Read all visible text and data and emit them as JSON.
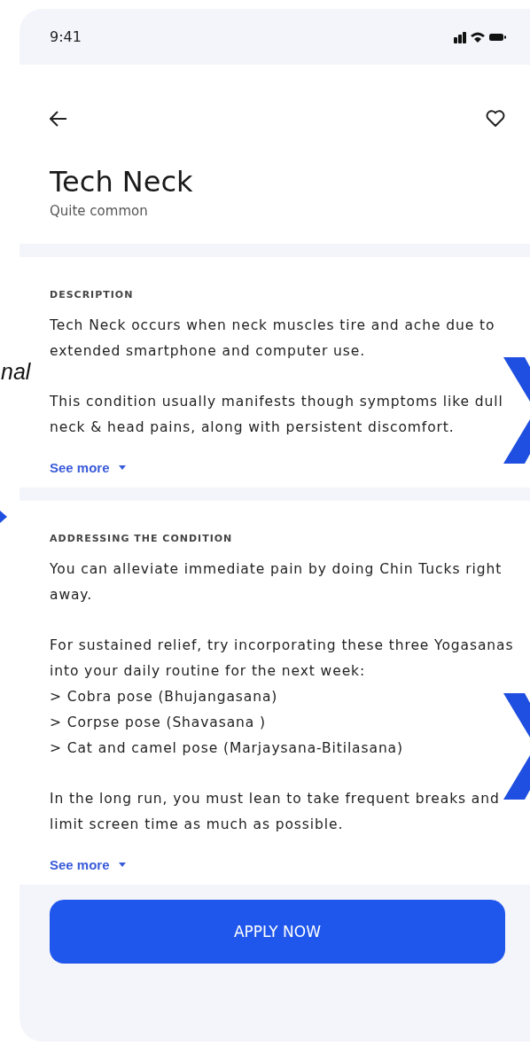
{
  "slide_fragment": {
    "text": "nal"
  },
  "status_bar": {
    "time": "9:41"
  },
  "header": {
    "title": "Tech Neck",
    "subtitle": "Quite common",
    "favorite": false
  },
  "sections": [
    {
      "heading": "DESCRIPTION",
      "paragraphs": [
        {
          "text": "Tech Neck occurs when neck muscles tire and ache due to extended smartphone and computer use."
        },
        {
          "text": "This condition usually manifests though symptoms like dull neck & head pains, along with persistent discomfort."
        }
      ],
      "link": "See more"
    },
    {
      "heading": "ADDRESSING THE CONDITION",
      "paragraphs": [
        {
          "text": "You can alleviate immediate pain by doing Chin Tucks right away."
        },
        {
          "text": "For sustained relief, try incorporating these three Yogasanas into your daily routine for the next week:",
          "items": [
            "> Cobra pose (Bhujangasana)",
            "> Corpse pose (Shavasana )",
            "> Cat and camel pose (Marjaysana-Bitilasana)"
          ]
        },
        {
          "text": "In the long run, you must lean to take frequent breaks and limit screen time as much as possible."
        }
      ],
      "link": "See more"
    }
  ],
  "button": {
    "label": "APPLY NOW"
  }
}
